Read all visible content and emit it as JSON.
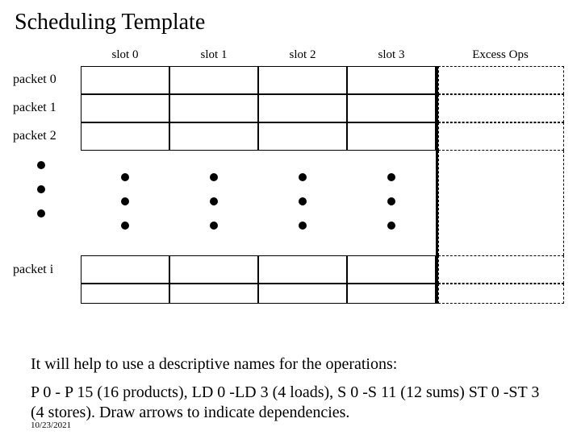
{
  "title": "Scheduling Template",
  "columns": {
    "slot0": "slot 0",
    "slot1": "slot 1",
    "slot2": "slot 2",
    "slot3": "slot 3",
    "excess": "Excess  Ops"
  },
  "rows": {
    "p0": "packet 0",
    "p1": "packet 1",
    "p2": "packet 2",
    "pi": "packet i"
  },
  "body": {
    "line1": "It will help to use a descriptive names for the operations:",
    "line2": "P 0 - P 15 (16 products), LD 0 -LD 3 (4 loads), S 0 -S 11 (12 sums) ST 0 -ST 3 (4 stores).  Draw arrows to indicate dependencies."
  },
  "footer_date": "10/23/2021"
}
